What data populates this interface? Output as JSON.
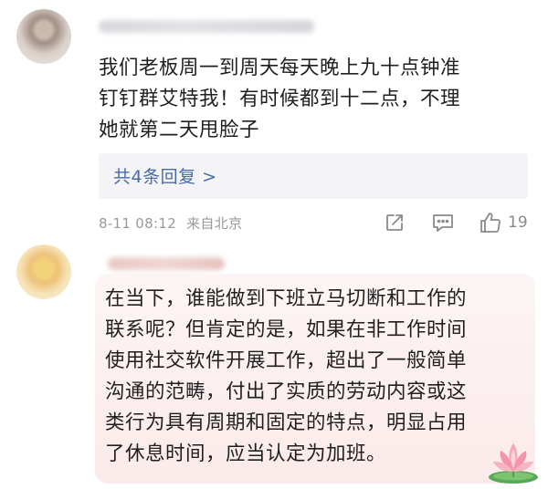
{
  "comments": [
    {
      "text": "我们老板周一到周天每天晚上九十点钟准\n钉钉群艾特我！有时候都到十二点，不理\n她就第二天甩脸子",
      "replies_label": "共4条回复 >",
      "time": "8-11 08:12",
      "location": "来自北京",
      "likes": "19",
      "icons": {
        "share": "share-icon",
        "comment": "comment-icon",
        "like": "thumbs-up-icon"
      }
    },
    {
      "text": "在当下，谁能做到下班立马切断和工作的\n联系呢？但肯定的是，如果在非工作时间\n使用社交软件开展工作，超出了一般简单\n沟通的范畴，付出了实质的劳动内容或这\n类行为具有周期和固定的特点，明显占用\n了休息时间，应当认定为加班。",
      "decoration": "lotus-icon"
    }
  ],
  "colors": {
    "link": "#476ba6",
    "meta": "#9a9a9a",
    "replies_bg": "#f4f4f6",
    "highlight_bg": "#fcefef"
  }
}
